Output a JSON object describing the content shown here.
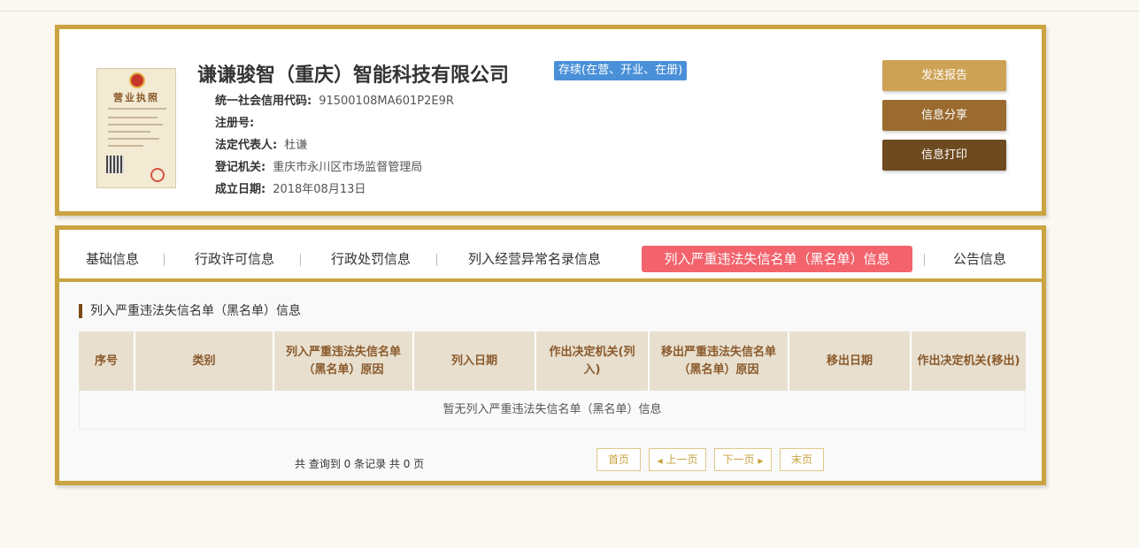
{
  "company": {
    "name": "谦谦骏智（重庆）智能科技有限公司",
    "status": "存续(在营、开业、在册)",
    "license_title": "营业执照",
    "fields": [
      {
        "label": "统一社会信用代码:",
        "value": "91500108MA601P2E9R"
      },
      {
        "label": "注册号:",
        "value": ""
      },
      {
        "label": "法定代表人:",
        "value": "杜谦"
      },
      {
        "label": "登记机关:",
        "value": "重庆市永川区市场监督管理局"
      },
      {
        "label": "成立日期:",
        "value": "2018年08月13日"
      }
    ]
  },
  "actions": {
    "send_report": "发送报告",
    "share": "信息分享",
    "print": "信息打印"
  },
  "tabs": [
    {
      "label": "基础信息",
      "active": false
    },
    {
      "label": "行政许可信息",
      "active": false
    },
    {
      "label": "行政处罚信息",
      "active": false
    },
    {
      "label": "列入经营异常名录信息",
      "active": false
    },
    {
      "label": "列入严重违法失信名单（黑名单）信息",
      "active": true
    },
    {
      "label": "公告信息",
      "active": false
    }
  ],
  "section": {
    "title": "列入严重违法失信名单（黑名单）信息",
    "columns": [
      "序号",
      "类别",
      "列入严重违法失信名单（黑名单）原因",
      "列入日期",
      "作出决定机关(列入)",
      "移出严重违法失信名单（黑名单）原因",
      "移出日期",
      "作出决定机关(移出)"
    ],
    "empty_text": "暂无列入严重违法失信名单（黑名单）信息"
  },
  "pagination": {
    "summary": "共 查询到 0 条记录 共 0 页",
    "first": "首页",
    "prev": "上一页",
    "next": "下一页",
    "last": "末页"
  },
  "colors": {
    "border_gold": "#c9a441",
    "status_blue": "#4a90d9",
    "tab_active": "#f2636c",
    "btn_send": "#cda254",
    "btn_share": "#9a6a2f",
    "btn_print": "#6d4a1f"
  }
}
